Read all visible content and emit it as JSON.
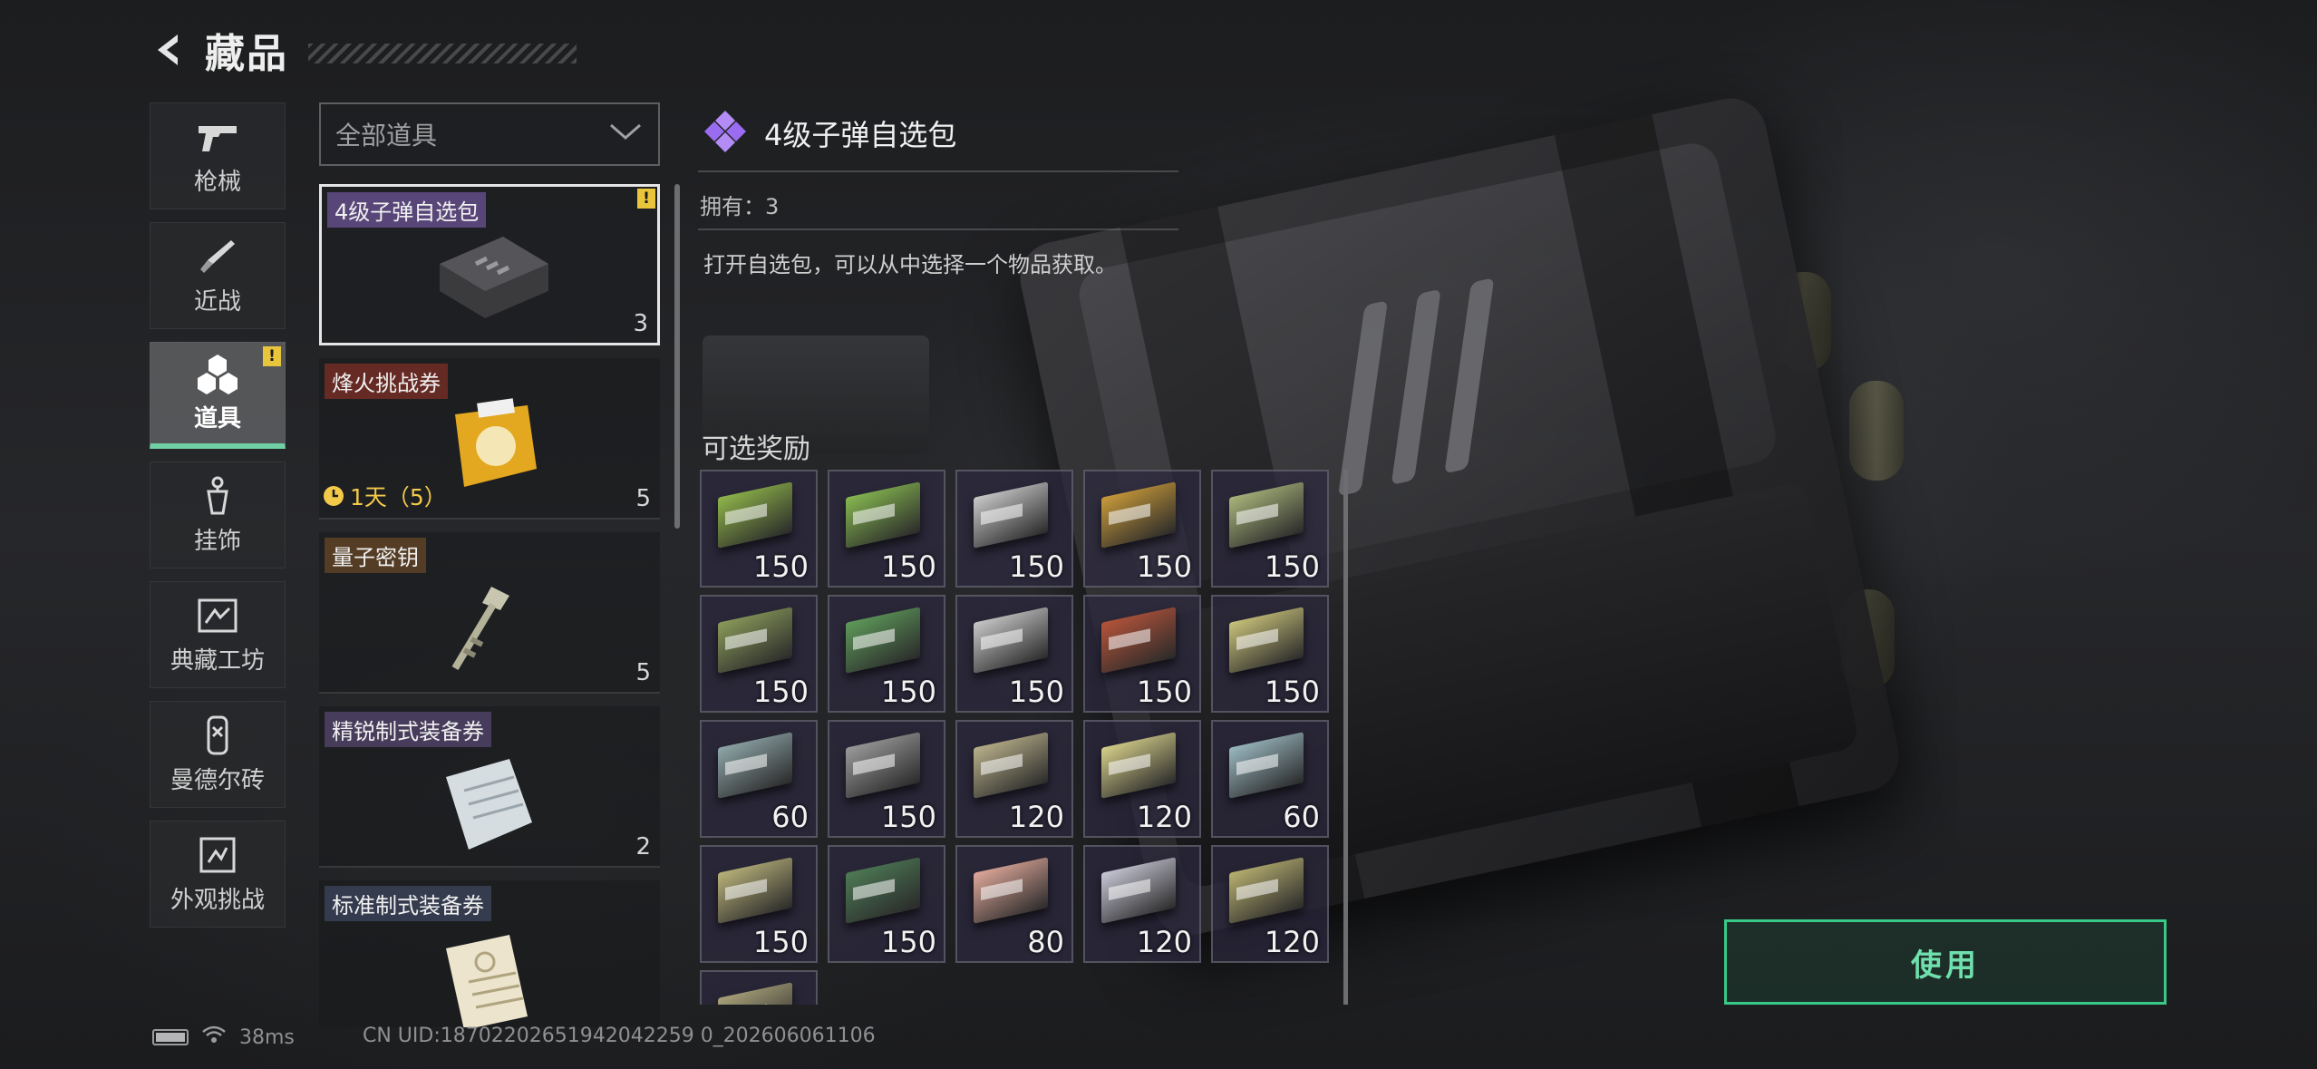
{
  "header": {
    "title": "藏品"
  },
  "nav": {
    "items": [
      {
        "label": "枪械",
        "icon": "pistol-icon"
      },
      {
        "label": "近战",
        "icon": "knife-icon"
      },
      {
        "label": "道具",
        "icon": "cubes-icon",
        "active": true
      },
      {
        "label": "挂饰",
        "icon": "charm-icon"
      },
      {
        "label": "典藏工坊",
        "icon": "frame-icon"
      },
      {
        "label": "曼德尔砖",
        "icon": "brick-icon"
      },
      {
        "label": "外观挑战",
        "icon": "challenge-icon"
      }
    ],
    "warning_mark": "!"
  },
  "filter": {
    "selected": "全部道具"
  },
  "items": [
    {
      "name": "4级子弹自选包",
      "count": "3",
      "selected": true,
      "warning": "!"
    },
    {
      "name": "烽火挑战券",
      "count": "5",
      "timer": "1天（5）"
    },
    {
      "name": "量子密钥",
      "count": "5"
    },
    {
      "name": "精锐制式装备券",
      "count": "2"
    },
    {
      "name": "标准制式装备券",
      "count": ""
    }
  ],
  "detail": {
    "name": "4级子弹自选包",
    "owned": "拥有：3",
    "description": "打开自选包，可以从中选择一个物品获取。",
    "rewards_label": "可选奖励",
    "accent_color": "#9a6cf0"
  },
  "rewards": [
    {
      "qty": "150",
      "color": "#8fb54a"
    },
    {
      "qty": "150",
      "color": "#86b850"
    },
    {
      "qty": "150",
      "color": "#c9c9c9"
    },
    {
      "qty": "150",
      "color": "#c99a3a"
    },
    {
      "qty": "150",
      "color": "#a8b47a"
    },
    {
      "qty": "150",
      "color": "#8a9a5a"
    },
    {
      "qty": "150",
      "color": "#5e9a5a"
    },
    {
      "qty": "150",
      "color": "#c8c8c8"
    },
    {
      "qty": "150",
      "color": "#b5543a"
    },
    {
      "qty": "150",
      "color": "#c9c27a"
    },
    {
      "qty": "60",
      "color": "#8fa6a8"
    },
    {
      "qty": "150",
      "color": "#9a9a9a"
    },
    {
      "qty": "120",
      "color": "#b9b08a"
    },
    {
      "qty": "120",
      "color": "#d6cf8a"
    },
    {
      "qty": "60",
      "color": "#9ab8c0"
    },
    {
      "qty": "150",
      "color": "#b9b27a"
    },
    {
      "qty": "150",
      "color": "#4d7a55"
    },
    {
      "qty": "80",
      "color": "#e0a89a"
    },
    {
      "qty": "120",
      "color": "#c8c8d6"
    },
    {
      "qty": "120",
      "color": "#b8b070"
    },
    {
      "qty": "",
      "color": "#a9a27a"
    }
  ],
  "actions": {
    "use_label": "使用"
  },
  "status": {
    "ping": "38ms",
    "uid": "CN UID:18702202651942042259 0_202606061106"
  }
}
